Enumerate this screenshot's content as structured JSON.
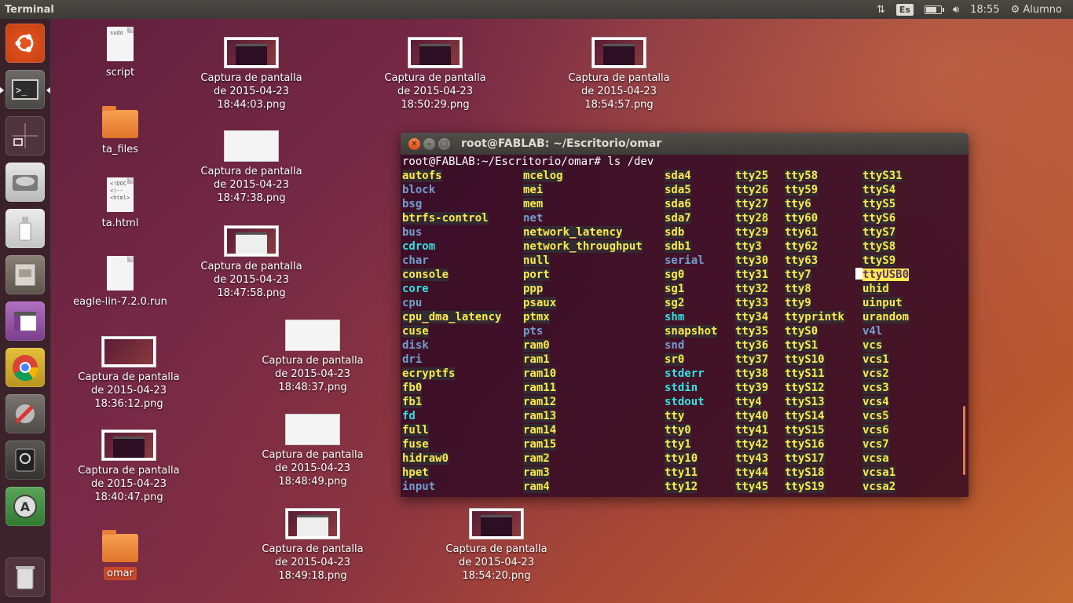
{
  "topbar": {
    "app_title": "Terminal",
    "keyboard": "Es",
    "clock": "18:55",
    "user": "Alumno",
    "battery_level": 0.7
  },
  "launcher": {
    "items": [
      "dash-home",
      "terminal",
      "workspace-switcher",
      "files-disk",
      "usb-drive",
      "file-manager",
      "unity-window",
      "chrome",
      "system-settings",
      "webcam",
      "software-updater",
      "trash"
    ]
  },
  "desktop": {
    "icons": [
      {
        "label": "script",
        "type": "doc",
        "doc_text": "sudo"
      },
      {
        "label": "ta_files",
        "type": "folder"
      },
      {
        "label": "ta.html",
        "type": "doc",
        "doc_text": "<!DOC\n<!--\n<html>"
      },
      {
        "label": "eagle-lin-7.2.0.run",
        "type": "doc",
        "doc_text": ""
      },
      {
        "label": "Captura de pantalla de 2015-04-23 18:36:12.png",
        "type": "thumb"
      },
      {
        "label": "Captura de pantalla de 2015-04-23 18:40:47.png",
        "type": "thumb"
      },
      {
        "label": "omar",
        "type": "folder"
      },
      {
        "label": "Captura de pantalla de 2015-04-23 18:44:03.png",
        "type": "thumb"
      },
      {
        "label": "Captura de pantalla de 2015-04-23 18:47:38.png",
        "type": "thumb"
      },
      {
        "label": "Captura de pantalla de 2015-04-23 18:47:58.png",
        "type": "thumb"
      },
      {
        "label": "Captura de pantalla de 2015-04-23 18:48:37.png",
        "type": "thumb"
      },
      {
        "label": "Captura de pantalla de 2015-04-23 18:48:49.png",
        "type": "thumb"
      },
      {
        "label": "Captura de pantalla de 2015-04-23 18:49:18.png",
        "type": "thumb"
      },
      {
        "label": "Captura de pantalla de 2015-04-23 18:50:29.png",
        "type": "thumb"
      },
      {
        "label": "Captura de pantalla de 2015-04-23 18:54:20.png",
        "type": "thumb"
      },
      {
        "label": "Captura de pantalla de 2015-04-23 18:54:57.png",
        "type": "thumb"
      }
    ]
  },
  "terminal": {
    "title": "root@FABLAB: ~/Escritorio/omar",
    "prompt": "root@FABLAB:~/Escritorio/omar# ls /dev",
    "colors": {
      "dir": "#729fcf",
      "link": "#34e2e2",
      "device": "#fce94f"
    },
    "columns": [
      [
        [
          "autofs",
          "y"
        ],
        [
          "block",
          "b"
        ],
        [
          "bsg",
          "b"
        ],
        [
          "btrfs-control",
          "y"
        ],
        [
          "bus",
          "b"
        ],
        [
          "cdrom",
          "c"
        ],
        [
          "char",
          "b"
        ],
        [
          "console",
          "y"
        ],
        [
          "core",
          "c"
        ],
        [
          "cpu",
          "b"
        ],
        [
          "cpu_dma_latency",
          "y"
        ],
        [
          "cuse",
          "y"
        ],
        [
          "disk",
          "b"
        ],
        [
          "dri",
          "b"
        ],
        [
          "ecryptfs",
          "y"
        ],
        [
          "fb0",
          "y"
        ],
        [
          "fb1",
          "y"
        ],
        [
          "fd",
          "c"
        ],
        [
          "full",
          "y"
        ],
        [
          "fuse",
          "y"
        ],
        [
          "hidraw0",
          "y"
        ],
        [
          "hpet",
          "y"
        ],
        [
          "input",
          "b"
        ]
      ],
      [
        [
          "mcelog",
          "y"
        ],
        [
          "mei",
          "y"
        ],
        [
          "mem",
          "y"
        ],
        [
          "net",
          "b"
        ],
        [
          "network_latency",
          "y"
        ],
        [
          "network_throughput",
          "y"
        ],
        [
          "null",
          "y"
        ],
        [
          "port",
          "y"
        ],
        [
          "ppp",
          "y"
        ],
        [
          "psaux",
          "y"
        ],
        [
          "ptmx",
          "y"
        ],
        [
          "pts",
          "b"
        ],
        [
          "ram0",
          "y"
        ],
        [
          "ram1",
          "y"
        ],
        [
          "ram10",
          "y"
        ],
        [
          "ram11",
          "y"
        ],
        [
          "ram12",
          "y"
        ],
        [
          "ram13",
          "y"
        ],
        [
          "ram14",
          "y"
        ],
        [
          "ram15",
          "y"
        ],
        [
          "ram2",
          "y"
        ],
        [
          "ram3",
          "y"
        ],
        [
          "ram4",
          "y"
        ]
      ],
      [
        [
          "sda4",
          "y"
        ],
        [
          "sda5",
          "y"
        ],
        [
          "sda6",
          "y"
        ],
        [
          "sda7",
          "y"
        ],
        [
          "sdb",
          "y"
        ],
        [
          "sdb1",
          "y"
        ],
        [
          "serial",
          "b"
        ],
        [
          "sg0",
          "y"
        ],
        [
          "sg1",
          "y"
        ],
        [
          "sg2",
          "y"
        ],
        [
          "shm",
          "c"
        ],
        [
          "snapshot",
          "y"
        ],
        [
          "snd",
          "b"
        ],
        [
          "sr0",
          "y"
        ],
        [
          "stderr",
          "c"
        ],
        [
          "stdin",
          "c"
        ],
        [
          "stdout",
          "c"
        ],
        [
          "tty",
          "y"
        ],
        [
          "tty0",
          "y"
        ],
        [
          "tty1",
          "y"
        ],
        [
          "tty10",
          "y"
        ],
        [
          "tty11",
          "y"
        ],
        [
          "tty12",
          "y"
        ]
      ],
      [
        [
          "tty25",
          "y"
        ],
        [
          "tty26",
          "y"
        ],
        [
          "tty27",
          "y"
        ],
        [
          "tty28",
          "y"
        ],
        [
          "tty29",
          "y"
        ],
        [
          "tty3",
          "y"
        ],
        [
          "tty30",
          "y"
        ],
        [
          "tty31",
          "y"
        ],
        [
          "tty32",
          "y"
        ],
        [
          "tty33",
          "y"
        ],
        [
          "tty34",
          "y"
        ],
        [
          "tty35",
          "y"
        ],
        [
          "tty36",
          "y"
        ],
        [
          "tty37",
          "y"
        ],
        [
          "tty38",
          "y"
        ],
        [
          "tty39",
          "y"
        ],
        [
          "tty4",
          "y"
        ],
        [
          "tty40",
          "y"
        ],
        [
          "tty41",
          "y"
        ],
        [
          "tty42",
          "y"
        ],
        [
          "tty43",
          "y"
        ],
        [
          "tty44",
          "y"
        ],
        [
          "tty45",
          "y"
        ]
      ],
      [
        [
          "tty58",
          "y"
        ],
        [
          "tty59",
          "y"
        ],
        [
          "tty6",
          "y"
        ],
        [
          "tty60",
          "y"
        ],
        [
          "tty61",
          "y"
        ],
        [
          "tty62",
          "y"
        ],
        [
          "tty63",
          "y"
        ],
        [
          "tty7",
          "y"
        ],
        [
          "tty8",
          "y"
        ],
        [
          "tty9",
          "y"
        ],
        [
          "ttyprintk",
          "y"
        ],
        [
          "ttyS0",
          "y"
        ],
        [
          "ttyS1",
          "y"
        ],
        [
          "ttyS10",
          "y"
        ],
        [
          "ttyS11",
          "y"
        ],
        [
          "ttyS12",
          "y"
        ],
        [
          "ttyS13",
          "y"
        ],
        [
          "ttyS14",
          "y"
        ],
        [
          "ttyS15",
          "y"
        ],
        [
          "ttyS16",
          "y"
        ],
        [
          "ttyS17",
          "y"
        ],
        [
          "ttyS18",
          "y"
        ],
        [
          "ttyS19",
          "y"
        ]
      ],
      [
        [
          "ttyS31",
          "y"
        ],
        [
          "ttyS4",
          "y"
        ],
        [
          "ttyS5",
          "y"
        ],
        [
          "ttyS6",
          "y"
        ],
        [
          "ttyS7",
          "y"
        ],
        [
          "ttyS8",
          "y"
        ],
        [
          "ttyS9",
          "y"
        ],
        [
          "ttyUSB0",
          "h"
        ],
        [
          "uhid",
          "y"
        ],
        [
          "uinput",
          "y"
        ],
        [
          "urandom",
          "y"
        ],
        [
          "v4l",
          "b"
        ],
        [
          "vcs",
          "y"
        ],
        [
          "vcs1",
          "y"
        ],
        [
          "vcs2",
          "y"
        ],
        [
          "vcs3",
          "y"
        ],
        [
          "vcs4",
          "y"
        ],
        [
          "vcs5",
          "y"
        ],
        [
          "vcs6",
          "y"
        ],
        [
          "vcs7",
          "y"
        ],
        [
          "vcsa",
          "y"
        ],
        [
          "vcsa1",
          "y"
        ],
        [
          "vcsa2",
          "y"
        ]
      ]
    ]
  }
}
